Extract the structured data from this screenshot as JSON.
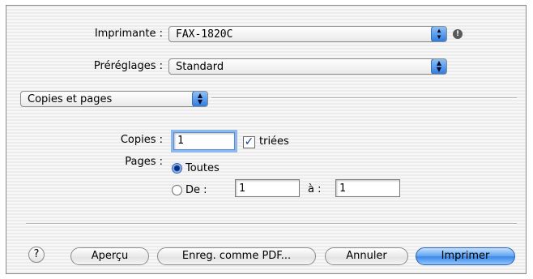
{
  "printer": {
    "label": "Imprimante :",
    "value": "FAX-1820C"
  },
  "presets": {
    "label": "Préréglages :",
    "value": "Standard"
  },
  "section": {
    "value": "Copies et pages"
  },
  "copies": {
    "label": "Copies :",
    "value": "1",
    "collate_label": "triées",
    "collate_checked": true
  },
  "pages": {
    "label": "Pages :",
    "all_label": "Toutes",
    "range_label": "De :",
    "from_value": "1",
    "to_label": "à :",
    "to_value": "1"
  },
  "buttons": {
    "help": "?",
    "preview": "Aperçu",
    "save_pdf": "Enreg. comme PDF...",
    "cancel": "Annuler",
    "print": "Imprimer"
  },
  "icons": {
    "stepper": "popup-arrows-icon",
    "warning": "exclamation-icon"
  }
}
